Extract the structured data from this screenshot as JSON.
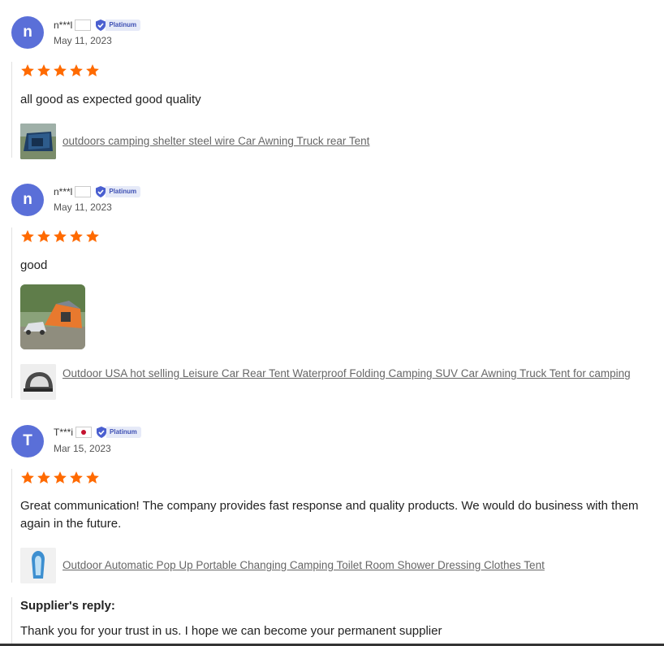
{
  "reviews": [
    {
      "avatar_letter": "n",
      "username": "n***l",
      "badge": "Platinum",
      "date": "May 11, 2023",
      "rating": 5,
      "text": "all good as expected good quality",
      "product": "outdoors camping shelter steel wire Car Awning Truck rear Tent"
    },
    {
      "avatar_letter": "n",
      "username": "n***l",
      "badge": "Platinum",
      "date": "May 11, 2023",
      "rating": 5,
      "text": "good",
      "product": "Outdoor USA hot selling Leisure Car Rear Tent Waterproof Folding Camping SUV Car Awning Truck Tent for camping"
    },
    {
      "avatar_letter": "T",
      "username": "T***i",
      "badge": "Platinum",
      "date": "Mar 15, 2023",
      "rating": 5,
      "text": "Great communication! The company provides fast response and quality products. We would do business with them again in the future.",
      "product": "Outdoor Automatic Pop Up Portable Changing Camping Toilet Room Shower Dressing Clothes Tent",
      "reply_title": "Supplier's reply:",
      "reply_text": "Thank you for your trust in us. I hope we can become your permanent supplier"
    }
  ],
  "colors": {
    "avatar": "#5a6fd8",
    "star": "#ff6a00",
    "badge_blue": "#4a5fd0"
  },
  "icons": {
    "star": "star-icon",
    "badge": "verified-badge-icon",
    "flag": "flag-icon"
  }
}
